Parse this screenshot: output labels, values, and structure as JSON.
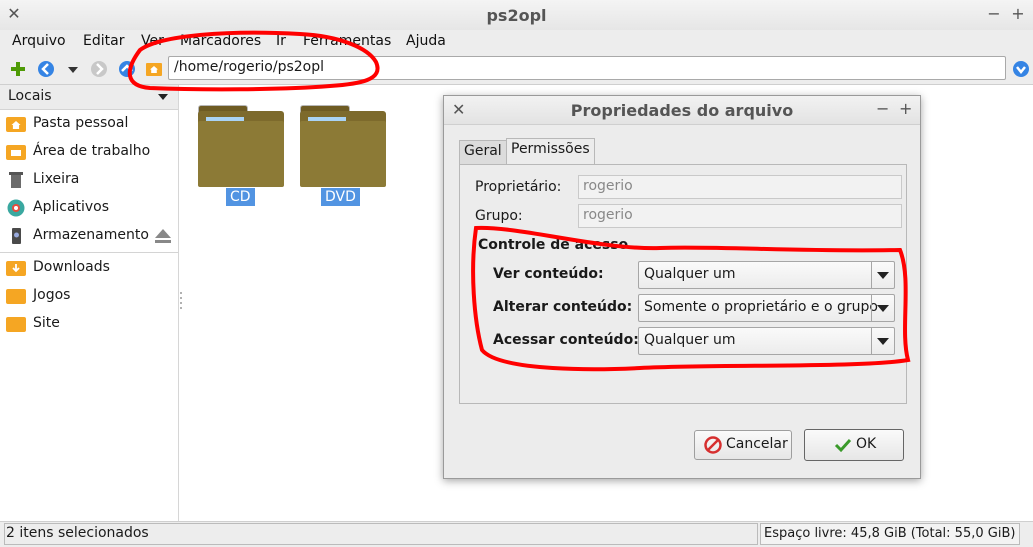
{
  "window": {
    "title": "ps2opl"
  },
  "menubar": {
    "items": [
      "Arquivo",
      "Editar",
      "Ver",
      "Marcadores",
      "Ir",
      "Ferramentas",
      "Ajuda"
    ]
  },
  "toolbar": {
    "path": "/home/rogerio/ps2opl"
  },
  "sidebar": {
    "header": "Locais",
    "places": [
      "Pasta pessoal",
      "Área de trabalho",
      "Lixeira",
      "Aplicativos",
      "Armazenamento"
    ],
    "bookmarks": [
      "Downloads",
      "Jogos",
      "Site"
    ]
  },
  "files": [
    {
      "name": "CD"
    },
    {
      "name": "DVD"
    }
  ],
  "status": {
    "selection": "2 itens selecionados",
    "free_space": "Espaço livre: 45,8 GiB (Total: 55,0 GiB)"
  },
  "dialog": {
    "title": "Propriedades do arquivo",
    "tabs": [
      "Geral",
      "Permissões"
    ],
    "owner_label": "Proprietário:",
    "owner_value": "rogerio",
    "group_label": "Grupo:",
    "group_value": "rogerio",
    "section_title": "Controle de acesso",
    "view_label": "Ver conteúdo:",
    "view_value": "Qualquer um",
    "change_label": "Alterar conteúdo:",
    "change_value": "Somente o proprietário e o grupo",
    "access_label": "Acessar conteúdo:",
    "access_value": "Qualquer um",
    "cancel_label": "Cancelar",
    "ok_label": "OK"
  },
  "colors": {
    "annotation": "#ff0000",
    "selection": "#5294e2",
    "folder": "#f5a623",
    "folder_dark": "#8c7a36"
  }
}
